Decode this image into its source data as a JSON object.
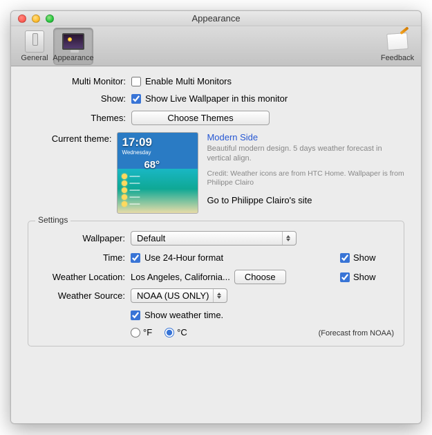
{
  "window": {
    "title": "Appearance"
  },
  "toolbar": {
    "general": "General",
    "appearance": "Appearance",
    "feedback": "Feedback"
  },
  "form": {
    "multiMonitor": {
      "label": "Multi Monitor:",
      "checkbox": "Enable Multi Monitors"
    },
    "show": {
      "label": "Show:",
      "checkbox": "Show Live Wallpaper in this monitor"
    },
    "themes": {
      "label": "Themes:",
      "button": "Choose Themes"
    },
    "currentTheme": {
      "label": "Current theme:"
    }
  },
  "theme": {
    "name": "Modern Side",
    "clock": "17:09",
    "day": "Wednesday",
    "temp": "68°",
    "desc": "Beautiful modern design. 5 days weather forecast in vertical align.",
    "credit": "Credit: Weather icons are from HTC Home. Wallpaper is from Philippe Clairo",
    "link": "Go to Philippe Clairo's site"
  },
  "settings": {
    "caption": "Settings",
    "wallpaper": {
      "label": "Wallpaper:",
      "value": "Default"
    },
    "time": {
      "label": "Time:",
      "checkbox": "Use 24-Hour format",
      "show": "Show"
    },
    "weatherLocation": {
      "label": "Weather Location:",
      "value": "Los Angeles, California...",
      "choose": "Choose",
      "show": "Show"
    },
    "weatherSource": {
      "label": "Weather Source:",
      "value": "NOAA (US ONLY)"
    },
    "showWeatherTime": "Show weather time.",
    "unitF": "°F",
    "unitC": "°C",
    "forecastNote": "(Forecast from NOAA)"
  }
}
